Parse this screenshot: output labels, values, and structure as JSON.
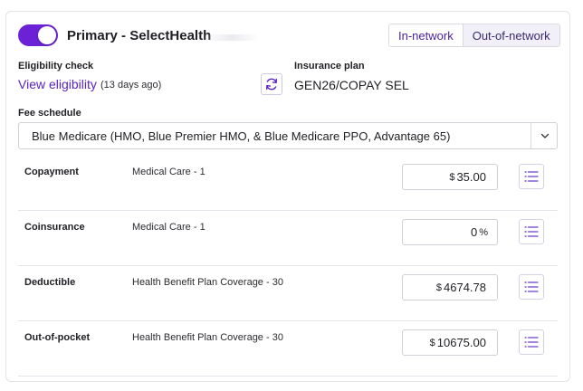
{
  "header": {
    "title": "Primary - SelectHealth",
    "toggle_on": true,
    "network_options": [
      "In-network",
      "Out-of-network"
    ],
    "network_selected": "Out-of-network"
  },
  "eligibility": {
    "label": "Eligibility check",
    "link_text": "View eligibility",
    "ago_text": "(13 days ago)",
    "refresh_icon": "refresh-icon"
  },
  "insurance_plan": {
    "label": "Insurance plan",
    "value": "GEN26/COPAY SEL"
  },
  "fee_schedule": {
    "label": "Fee schedule",
    "selected": "Blue Medicare (HMO, Blue Premier HMO, & Blue Medicare PPO, Advantage 65)",
    "dropdown_icon": "chevron-down-icon"
  },
  "benefits": [
    {
      "name": "Copayment",
      "description": "Medical Care - 1",
      "prefix": "$",
      "value": "35.00",
      "suffix": ""
    },
    {
      "name": "Coinsurance",
      "description": "Medical Care - 1",
      "prefix": "",
      "value": "0",
      "suffix": "%"
    },
    {
      "name": "Deductible",
      "description": "Health Benefit Plan Coverage - 30",
      "prefix": "$",
      "value": "4674.78",
      "suffix": ""
    },
    {
      "name": "Out-of-pocket",
      "description": "Health Benefit Plan Coverage - 30",
      "prefix": "$",
      "value": "10675.00",
      "suffix": ""
    }
  ],
  "colors": {
    "accent": "#6b22d6",
    "link": "#5b23c4",
    "segment_active_bg": "#f1eff7"
  }
}
